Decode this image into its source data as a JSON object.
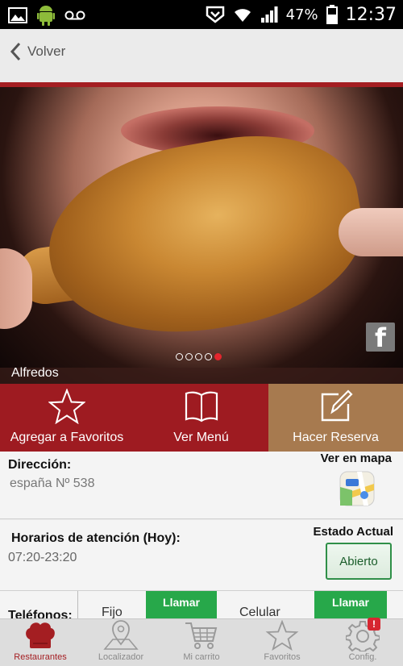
{
  "status_bar": {
    "battery_pct": "47%",
    "time": "12:37"
  },
  "topbar": {
    "back_label": "Volver"
  },
  "hero": {
    "restaurant_name": "Alfredos",
    "slide_count": 5,
    "active_slide": 5
  },
  "actions": [
    {
      "label": "Agregar a Favoritos",
      "icon": "star-icon",
      "color": "#9e1b21"
    },
    {
      "label": "Ver Menú",
      "icon": "book-icon",
      "color": "#9e1b21"
    },
    {
      "label": "Hacer Reserva",
      "icon": "edit-icon",
      "color": "#a77a4f"
    }
  ],
  "address": {
    "title": "Dirección:",
    "value": "españa Nº 538",
    "map_title": "Ver en mapa"
  },
  "hours": {
    "title": "Horarios de atención (Hoy):",
    "value": "07:20-23:20",
    "state_title": "Estado Actual",
    "state_value": "Abierto"
  },
  "phones": {
    "label": "Teléfonos:",
    "fixed_label": "Fijo",
    "mobile_label": "Celular",
    "call_label": "Llamar"
  },
  "bottom_nav": [
    {
      "label": "Restaurantes",
      "icon": "chef-hat-icon",
      "active": true
    },
    {
      "label": "Localizador",
      "icon": "map-pin-icon",
      "active": false
    },
    {
      "label": "Mi carrito",
      "icon": "cart-icon",
      "active": false
    },
    {
      "label": "Favoritos",
      "icon": "star-icon",
      "active": false
    },
    {
      "label": "Config.",
      "icon": "gear-icon",
      "active": false,
      "badge": "!"
    }
  ],
  "colors": {
    "brand_red": "#a41e22",
    "action_brown": "#a77a4f",
    "call_green": "#27a84a"
  }
}
